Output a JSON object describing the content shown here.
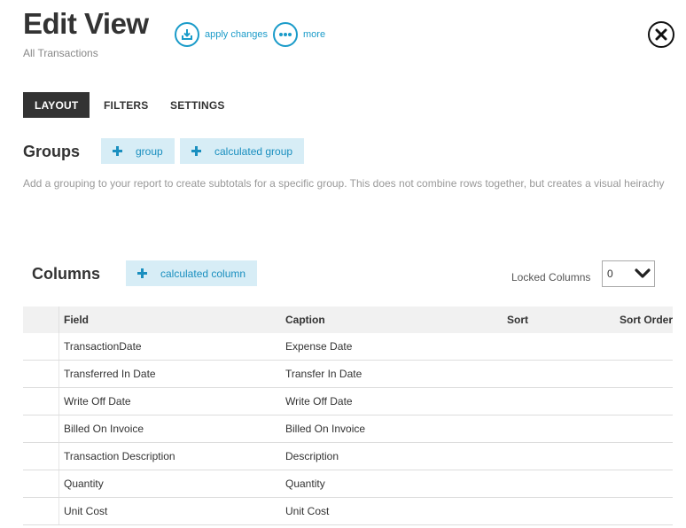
{
  "header": {
    "title": "Edit View",
    "subtitle": "All Transactions",
    "apply_label": "apply changes",
    "more_label": "more"
  },
  "tabs": [
    {
      "label": "LAYOUT",
      "active": true
    },
    {
      "label": "FILTERS",
      "active": false
    },
    {
      "label": "SETTINGS",
      "active": false
    }
  ],
  "groups": {
    "heading": "Groups",
    "add_group_label": "group",
    "add_calc_group_label": "calculated group",
    "help_text": "Add a grouping to your report to create subtotals for a specific group. This does not combine rows together, but creates a visual heirachy"
  },
  "columns": {
    "heading": "Columns",
    "add_calc_column_label": "calculated column",
    "locked_label": "Locked Columns",
    "locked_value": "0",
    "table_headers": {
      "field": "Field",
      "caption": "Caption",
      "sort": "Sort",
      "sort_order": "Sort Order"
    },
    "rows": [
      {
        "field": "TransactionDate",
        "caption": "Expense Date"
      },
      {
        "field": "Transferred In Date",
        "caption": "Transfer In Date"
      },
      {
        "field": "Write Off Date",
        "caption": "Write Off Date"
      },
      {
        "field": "Billed On Invoice",
        "caption": "Billed On Invoice"
      },
      {
        "field": "Transaction Description",
        "caption": "Description"
      },
      {
        "field": "Quantity",
        "caption": "Quantity"
      },
      {
        "field": "Unit Cost",
        "caption": "Unit Cost"
      }
    ]
  },
  "colors": {
    "accent": "#1a9bc9",
    "add_button_bg": "#d7edf6",
    "active_tab_bg": "#333333"
  },
  "icons": {
    "apply": "download-icon",
    "more": "ellipsis-icon",
    "close": "close-icon",
    "add": "plus-icon",
    "dropdown": "chevron-down-icon"
  }
}
